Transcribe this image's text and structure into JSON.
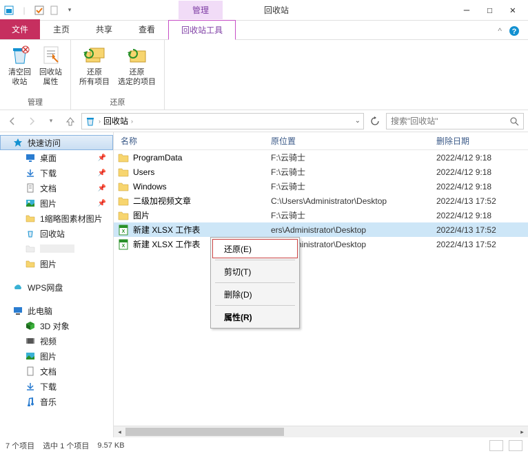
{
  "titlebar": {
    "tab_manage": "管理",
    "tab_recycle": "回收站"
  },
  "menubar": {
    "file": "文件",
    "home": "主页",
    "share": "共享",
    "view": "查看",
    "tools": "回收站工具"
  },
  "ribbon": {
    "empty": "清空回\n收站",
    "props": "回收站\n属性",
    "restore_all": "还原\n所有项目",
    "restore_sel": "还原\n选定的项目",
    "group_manage": "管理",
    "group_restore": "还原"
  },
  "breadcrumb": {
    "location": "回收站"
  },
  "search": {
    "placeholder": "搜索\"回收站\""
  },
  "sidebar": {
    "quick": "快速访问",
    "desktop": "桌面",
    "downloads": "下载",
    "documents": "文档",
    "pictures": "图片",
    "thumb": "1缩略图素材图片",
    "recycle": "回收站",
    "blank": "",
    "pics2": "图片",
    "wps": "WPS网盘",
    "thispc": "此电脑",
    "obj3d": "3D 对象",
    "video": "视频",
    "pictures2": "图片",
    "docs2": "文档",
    "dl2": "下载",
    "music": "音乐"
  },
  "headers": {
    "name": "名称",
    "orig": "原位置",
    "date": "删除日期"
  },
  "rows": [
    {
      "name": "ProgramData",
      "orig": "F:\\云骑士",
      "date": "2022/4/12 9:18",
      "ico": "folder"
    },
    {
      "name": "Users",
      "orig": "F:\\云骑士",
      "date": "2022/4/12 9:18",
      "ico": "folder"
    },
    {
      "name": "Windows",
      "orig": "F:\\云骑士",
      "date": "2022/4/12 9:18",
      "ico": "folder"
    },
    {
      "name": "二级加视频文章",
      "orig": "C:\\Users\\Administrator\\Desktop",
      "date": "2022/4/13 17:52",
      "ico": "folder"
    },
    {
      "name": "图片",
      "orig": "F:\\云骑士",
      "date": "2022/4/12 9:18",
      "ico": "folder"
    },
    {
      "name": "新建 XLSX 工作表",
      "orig": "ers\\Administrator\\Desktop",
      "date": "2022/4/13 17:52",
      "ico": "xlsx"
    },
    {
      "name": "新建 XLSX 工作表",
      "orig": "ers\\Administrator\\Desktop",
      "date": "2022/4/13 17:52",
      "ico": "xlsx"
    }
  ],
  "context": {
    "restore": "还原(E)",
    "cut": "剪切(T)",
    "delete": "删除(D)",
    "props": "属性(R)"
  },
  "status": {
    "count": "7 个项目",
    "selected": "选中 1 个项目",
    "size": "9.57 KB"
  }
}
